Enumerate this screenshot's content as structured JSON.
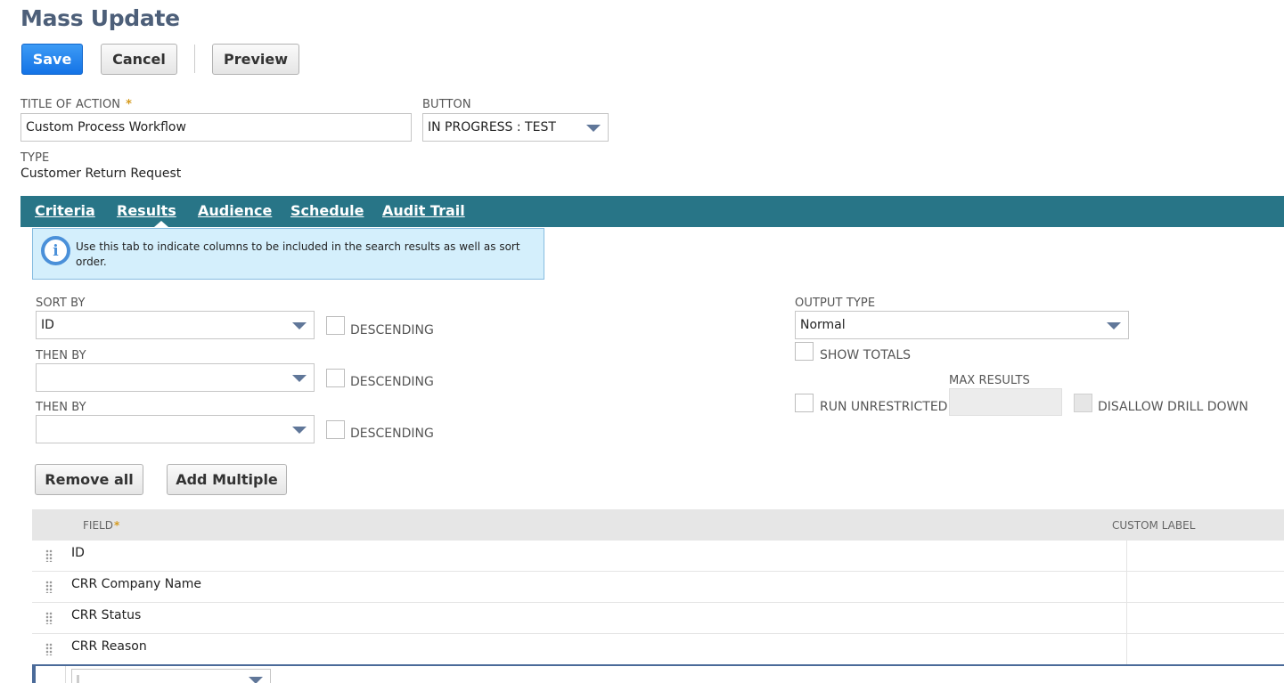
{
  "page": {
    "title": "Mass Update"
  },
  "toolbar": {
    "save": "Save",
    "cancel": "Cancel",
    "preview": "Preview"
  },
  "form": {
    "title_of_action": {
      "label": "TITLE OF ACTION",
      "required_mark": "*",
      "value": "Custom Process Workflow"
    },
    "button": {
      "label": "BUTTON",
      "value": "IN PROGRESS : TEST"
    },
    "type": {
      "label": "TYPE",
      "value": "Customer Return Request"
    }
  },
  "tabs": [
    {
      "label": "Criteria"
    },
    {
      "label": "Results",
      "active": true
    },
    {
      "label": "Audience"
    },
    {
      "label": "Schedule"
    },
    {
      "label": "Audit Trail"
    }
  ],
  "info": {
    "text": "Use this tab to indicate columns to be included in the search results as well as sort order."
  },
  "sort": {
    "sort_by": {
      "label": "SORT BY",
      "value": "ID"
    },
    "then_by_1": {
      "label": "THEN BY",
      "value": ""
    },
    "then_by_2": {
      "label": "THEN BY",
      "value": ""
    },
    "descending_label": "DESCENDING"
  },
  "output": {
    "type_label": "OUTPUT TYPE",
    "type_value": "Normal",
    "show_totals": "SHOW TOTALS",
    "max_results": "MAX RESULTS",
    "run_unrestricted": "RUN UNRESTRICTED",
    "disallow_drill_down": "DISALLOW DRILL DOWN"
  },
  "actions": {
    "remove_all": "Remove all",
    "add_multiple": "Add Multiple"
  },
  "table": {
    "field_header": "FIELD",
    "required_mark": "*",
    "custom_label_header": "CUSTOM LABEL",
    "rows": [
      {
        "field": "ID"
      },
      {
        "field": "CRR Company Name"
      },
      {
        "field": "CRR Status"
      },
      {
        "field": "CRR Reason"
      }
    ]
  },
  "colors": {
    "tab_bar": "#287587",
    "primary_button": "#1473e6",
    "info_bg": "#d4effc",
    "title": "#4d5f79"
  }
}
